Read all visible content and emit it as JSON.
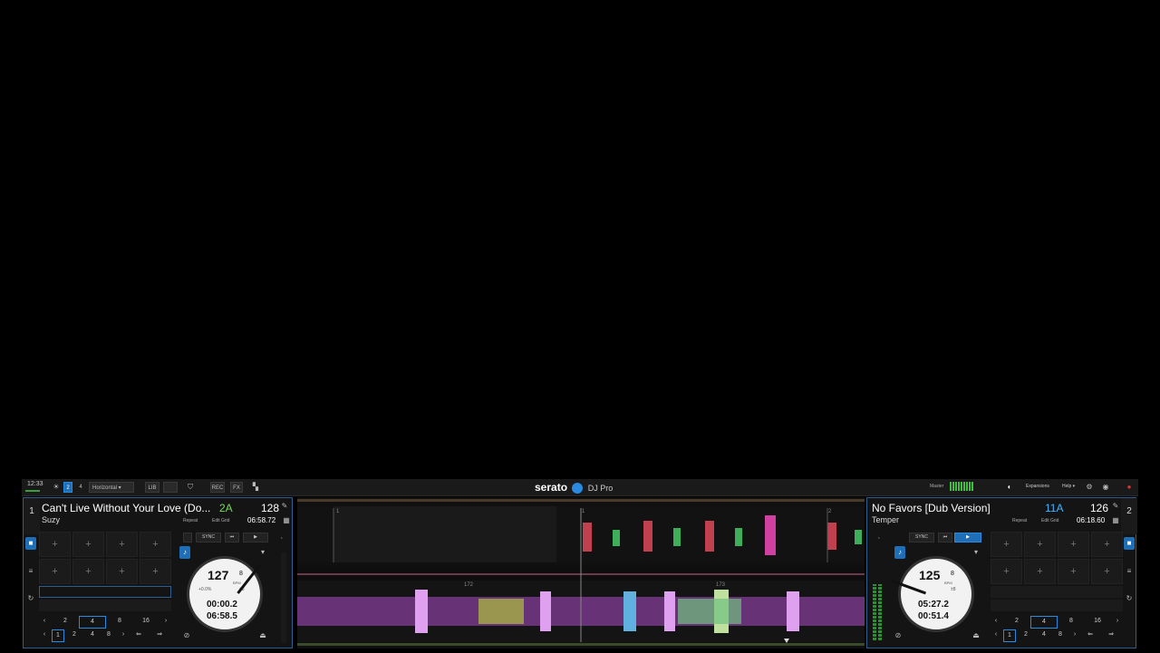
{
  "topbar": {
    "clock": "12:33",
    "deck_count_a": "2",
    "deck_count_b": "4",
    "layout_select": "Horizontal",
    "lib_label": "LIB",
    "rec_label": "REC",
    "fx_label": "FX",
    "logo_main": "serato",
    "logo_sub": "DJ Pro",
    "master_label": "Master",
    "expansions_label": "Expansions",
    "help_label": "Help"
  },
  "deck1": {
    "number": "1",
    "title": "Can't Live Without Your Love (Do...",
    "artist": "Suzy",
    "key": "2A",
    "bpm": "128",
    "repeat_label": "Repeat",
    "edit_grid_label": "Edit Grid",
    "duration": "06:58.72",
    "sync_label": "SYNC",
    "platter": {
      "bpm_main": "127",
      "bpm_decimal": "8",
      "bpm_unit": "BPM",
      "pitch": "+0.0%",
      "range": "±8",
      "elapsed": "00:00.2",
      "remaining": "06:58.5"
    },
    "loop_sizes": [
      "2",
      "4",
      "8",
      "16"
    ],
    "beatjump_sizes": [
      "1",
      "2",
      "4",
      "8"
    ]
  },
  "deck2": {
    "number": "2",
    "title": "No Favors [Dub Version]",
    "artist": "Temper",
    "key": "11A",
    "bpm": "126",
    "repeat_label": "Repeat",
    "edit_grid_label": "Edit Grid",
    "duration": "06:18.60",
    "sync_label": "SYNC",
    "platter": {
      "bpm_main": "125",
      "bpm_decimal": "8",
      "bpm_unit": "BPM",
      "range": "±8",
      "elapsed": "05:27.2",
      "remaining": "00:51.4"
    },
    "loop_sizes": [
      "2",
      "4",
      "8",
      "16"
    ],
    "beatjump_sizes": [
      "1",
      "2",
      "4",
      "8"
    ]
  },
  "waveform": {
    "top_marker_a": "1",
    "top_marker_b": "1",
    "top_marker_c": "2",
    "bar_a": "172",
    "bar_b": "173"
  },
  "colors": {
    "accent": "#1f6fb8",
    "deck_border": "#2a5f8f",
    "key_deck1": "#6fe04b",
    "key_deck2": "#3fb4ff"
  }
}
